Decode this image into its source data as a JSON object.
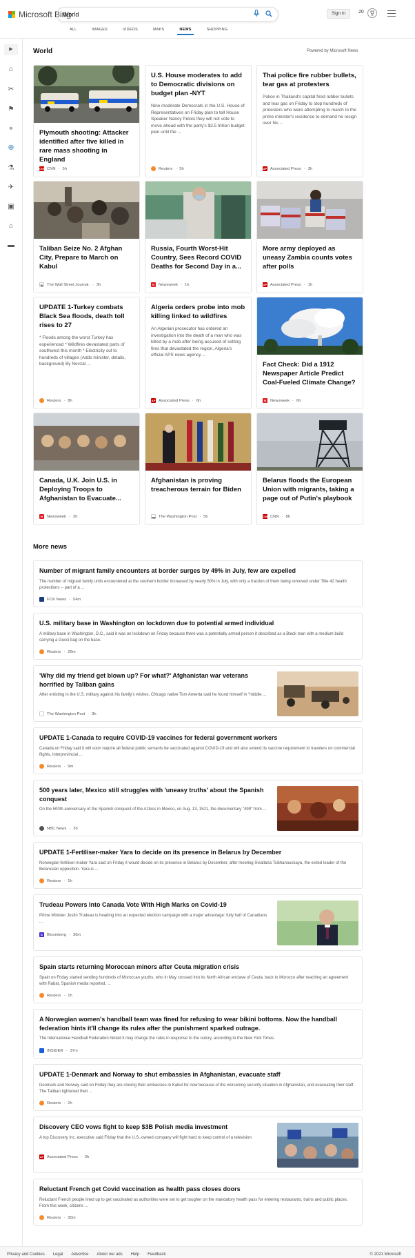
{
  "header": {
    "brand": "Microsoft Bing",
    "search_value": "World",
    "signin_label": "Sign in",
    "points": "20",
    "tabs": [
      {
        "label": "ALL",
        "active": false
      },
      {
        "label": "IMAGES",
        "active": false
      },
      {
        "label": "VIDEOS",
        "active": false
      },
      {
        "label": "MAPS",
        "active": false
      },
      {
        "label": "NEWS",
        "active": true
      },
      {
        "label": "SHOPPING",
        "active": false
      }
    ]
  },
  "rail": {
    "icons": [
      "expand-icon",
      "home-icon",
      "scitech-icon",
      "flag-icon",
      "location-icon",
      "globe-icon",
      "science-icon",
      "rocket-icon",
      "entertainment-icon",
      "money-icon",
      "sports-icon"
    ],
    "active": "globe-icon"
  },
  "world": {
    "heading": "World",
    "powered_by": "Powered by Microsoft News",
    "cards": [
      {
        "title": "Plymouth shooting: Attacker identified after five killed in rare mass shooting in England",
        "snippet": "",
        "source": "CNN",
        "time": "5h",
        "logo_color": "#cc0000",
        "logo_text": "CNN"
      },
      {
        "title": "U.S. House moderates to add to Democratic divisions on budget plan -NYT",
        "snippet": "Nine moderate Democrats in the U.S. House of Representatives on Friday plan to tell House Speaker Nancy Pelosi they will not vote to move ahead with the party's $3.5 trillion budget plan until the ...",
        "source": "Reuters",
        "time": "5h",
        "logo_color": "#f48a2a",
        "logo_text": ""
      },
      {
        "title": "Thai police fire rubber bullets, tear gas at protesters",
        "snippet": "Police in Thailand's capital fired rubber bullets and tear gas on Friday to stop hundreds of protesters who were attempting to march to the prime minister's residence to demand he resign over his ...",
        "source": "Associated Press",
        "time": "3h",
        "logo_color": "#cc0000",
        "logo_text": "AP"
      },
      {
        "title": "Taliban Seize No. 2 Afghan City, Prepare to March on Kabul",
        "snippet": "",
        "source": "The Wall Street Journal.",
        "time": "3h",
        "logo_color": "#222222",
        "logo_text": "W"
      },
      {
        "title": "Russia, Fourth Worst-Hit Country, Sees Record COVID Deaths for Second Day in a...",
        "snippet": "",
        "source": "Newsweek",
        "time": "1h",
        "logo_color": "#e31e26",
        "logo_text": "N"
      },
      {
        "title": "More army deployed as uneasy Zambia counts votes after polls",
        "snippet": "",
        "source": "Associated Press",
        "time": "1h",
        "logo_color": "#cc0000",
        "logo_text": "AP"
      },
      {
        "title": "UPDATE 1-Turkey combats Black Sea floods, death toll rises to 27",
        "snippet": "* Floods among the worst Turkey has experienced * Wildfires devastated parts of southwest this month * Electricity cut to hundreds of villages (Adds minister, details, background) By Nevzat ...",
        "source": "Reuters",
        "time": "8h",
        "logo_color": "#f48a2a",
        "logo_text": ""
      },
      {
        "title": "Algeria orders probe into mob killing linked to wildfires",
        "snippet": "An Algerian prosecutor has ordered an investigation into the death of a man who was killed by a mob after being accused of setting fires that devastated the region, Algeria's official APS news agency ...",
        "source": "Associated Press",
        "time": "6h",
        "logo_color": "#cc0000",
        "logo_text": "AP"
      },
      {
        "title": "Fact Check: Did a 1912 Newspaper Article Predict Coal-Fueled Climate Change?",
        "snippet": "",
        "source": "Newsweek",
        "time": "6h",
        "logo_color": "#e31e26",
        "logo_text": "N"
      },
      {
        "title": "Canada, U.K. Join U.S. in Deploying Troops to Afghanistan to Evacuate...",
        "snippet": "",
        "source": "Newsweek",
        "time": "3h",
        "logo_color": "#e31e26",
        "logo_text": "N"
      },
      {
        "title": "Afghanistan is proving treacherous terrain for Biden",
        "snippet": "",
        "source": "The Washington Post",
        "time": "5h",
        "logo_color": "#222222",
        "logo_text": "wp"
      },
      {
        "title": "Belarus floods the European Union with migrants, taking a page out of Putin's playbook",
        "snippet": "",
        "source": "CNN",
        "time": "8h",
        "logo_color": "#cc0000",
        "logo_text": "CNN"
      }
    ]
  },
  "more": {
    "heading": "More news",
    "items": [
      {
        "title": "Number of migrant family encounters at border surges by 49% in July, few are expelled",
        "snippet": "The number of migrant family units encountered at the southern border increased by nearly 50% in July, with only a fraction of them being removed under Title 42 health protections -- part of a ...",
        "source": "FOX News",
        "time": "54m",
        "logo_color": "#1a3a7a"
      },
      {
        "title": "U.S. military base in Washington on lockdown due to potential armed individual",
        "snippet": "A military base in Washington, D.C., said it was on lockdown on Friday because there was a potentially armed person it described as a Black man with a medium build carrying a Gucci bag on the base.",
        "source": "Reuters",
        "time": "26m",
        "logo_color": "#f48a2a"
      },
      {
        "title": "'Why did my friend get blown up? For what?' Afghanistan war veterans horrified by Taliban gains",
        "snippet": "After enlisting in the U.S. military against his family's wishes, Chicago native Tom Amenta said he found himself in \"middle ...",
        "source": "The Washington Post",
        "time": "3h",
        "logo_color": "#222222"
      },
      {
        "title": "UPDATE 1-Canada to require COVID-19 vaccines for federal government workers",
        "snippet": "Canada on Friday said it will soon require all federal public servants be vaccinated against COVID-19 and will also extend its vaccine requirement to travelers on commercial flights, interprovincial ...",
        "source": "Reuters",
        "time": "9m",
        "logo_color": "#f48a2a"
      },
      {
        "title": "500 years later, Mexico still struggles with 'uneasy truths' about the Spanish conquest",
        "snippet": "On the 500th anniversary of the Spanish conquest of the Aztecs in Mexico, on Aug. 13, 1521, the documentary \"499\" from ...",
        "source": "NBC News",
        "time": "3h",
        "logo_color": "#555555"
      },
      {
        "title": "UPDATE 1-Fertiliser-maker Yara to decide on its presence in Belarus by December",
        "snippet": "Norwegian fertiliser-maker Yara said on Friday it would decide on its presence in Belarus by December, after meeting Sviatlana Tsikhanouskaya, the exiled leader of the Belarusian opposition. Yara is ...",
        "source": "Reuters",
        "time": "1h",
        "logo_color": "#f48a2a"
      },
      {
        "title": "Trudeau Powers Into Canada Vote With High Marks on Covid-19",
        "snippet": "Prime Minister Justin Trudeau is heading into an expected election campaign with a major advantage: fully half of Canadians ...",
        "source": "Bloomberg",
        "time": "36m",
        "logo_color": "#472ecc"
      },
      {
        "title": "Spain starts returning Moroccan minors after Ceuta migration crisis",
        "snippet": "Spain on Friday started sending hundreds of Moroccan youths, who in May crossed into its North African enclave of Ceuta, back to Morocco after reaching an agreement with Rabat, Spanish media reported, ...",
        "source": "Reuters",
        "time": "1h",
        "logo_color": "#f48a2a"
      },
      {
        "title": "A Norwegian women's handball team was fined for refusing to wear bikini bottoms. Now the handball federation hints it'll change its rules after the punishment sparked outrage.",
        "snippet": "The International Handball Federation hinted it may change the rules in response to the outcry, according to the New York Times.",
        "source": "INSIDER",
        "time": "37m",
        "logo_color": "#1a5fd6"
      },
      {
        "title": "UPDATE 1-Denmark and Norway to shut embassies in Afghanistan, evacuate staff",
        "snippet": "Denmark and Norway said on Friday they are closing their embassies in Kabul for now because of the worsening security situation in Afghanistan, and evacuating their staff. The Taliban tightened their ...",
        "source": "Reuters",
        "time": "2h",
        "logo_color": "#f48a2a"
      },
      {
        "title": "Discovery CEO vows fight to keep $3B Polish media investment",
        "snippet": "A top Discovery Inc. executive said Friday that the U.S.-owned company will fight hard to keep control of a television",
        "source": "Associated Press",
        "time": "3h",
        "logo_color": "#cc0000"
      },
      {
        "title": "Reluctant French get Covid vaccination as health pass closes doors",
        "snippet": "Reluctant French people lined up to get vaccinated as authorities were set to get tougher on the mandatory health pass for entering restaurants, trains and public places. From this week, citizens ...",
        "source": "Reuters",
        "time": "30m",
        "logo_color": "#f48a2a"
      }
    ]
  },
  "footer": {
    "links": [
      "Privacy and Cookies",
      "Legal",
      "Advertise",
      "About our ads",
      "Help",
      "Feedback"
    ],
    "copyright": "© 2021 Microsoft"
  }
}
